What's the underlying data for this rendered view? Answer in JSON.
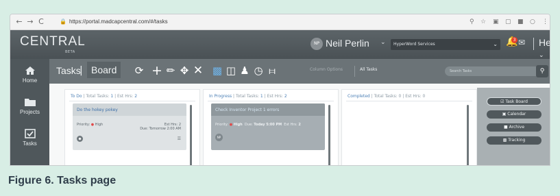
{
  "browser": {
    "url": "https://portal.madcapcentral.com/#/tasks",
    "back_icon": "arrow-left-icon",
    "forward_icon": "arrow-right-icon",
    "reload_icon": "reload-icon"
  },
  "header": {
    "logo": "CENTRAL",
    "logo_sub": "BETA",
    "avatar_initials": "NP",
    "user_name": "Neil Perlin",
    "workspace": "HyperWord Services",
    "notification_count": "3",
    "help_label": "Help"
  },
  "sidebar": {
    "items": [
      {
        "label": "Home",
        "icon": "home-icon"
      },
      {
        "label": "Projects",
        "icon": "folder-icon"
      },
      {
        "label": "Tasks",
        "icon": "checkbox-icon"
      }
    ]
  },
  "toolbar": {
    "title_tasks": "Tasks",
    "title_sep": "|",
    "title_board": "Board",
    "column_options": "Column Options",
    "all_tasks": "All Tasks",
    "search_placeholder": "Search Tasks"
  },
  "columns": [
    {
      "name": "To Do",
      "total_label": "Total Tasks:",
      "total": "1",
      "est_label": "Est Hrs:",
      "est": "2",
      "card": {
        "title": "Do the hokey pokey",
        "priority_label": "Priority:",
        "priority": "High",
        "est_label": "Est Hrs:",
        "est": "2",
        "due_label": "Due:",
        "due": "Tomorrow 2:00 AM"
      }
    },
    {
      "name": "In Progress",
      "total_label": "Total Tasks:",
      "total": "1",
      "est_label": "Est Hrs:",
      "est": "2",
      "card": {
        "title": "Check Inventor Project 1 errors",
        "priority_label": "Priority:",
        "priority": "High",
        "due_label": "Due:",
        "due": "Today 5:00 PM",
        "est_label": "Est Hrs:",
        "est": "2",
        "avatar": "NP"
      }
    },
    {
      "name": "Completed",
      "total_label": "Total Tasks:",
      "total": "0",
      "est_label": "Est Hrs:",
      "est": "0"
    }
  ],
  "views": [
    {
      "label": "Task Board",
      "icon": "checkbox-icon",
      "active": true
    },
    {
      "label": "Calendar",
      "icon": "calendar-icon",
      "active": false
    },
    {
      "label": "Archive",
      "icon": "archive-icon",
      "active": false
    },
    {
      "label": "Tracking",
      "icon": "tracking-icon",
      "active": false
    }
  ],
  "caption": "Figure 6. Tasks page",
  "colors": {
    "background": "#d8eee5",
    "header": "#4a5155",
    "accent_blue": "#4b7fb5",
    "bell": "#f2b31b",
    "priority_dot": "#e04b4b"
  }
}
